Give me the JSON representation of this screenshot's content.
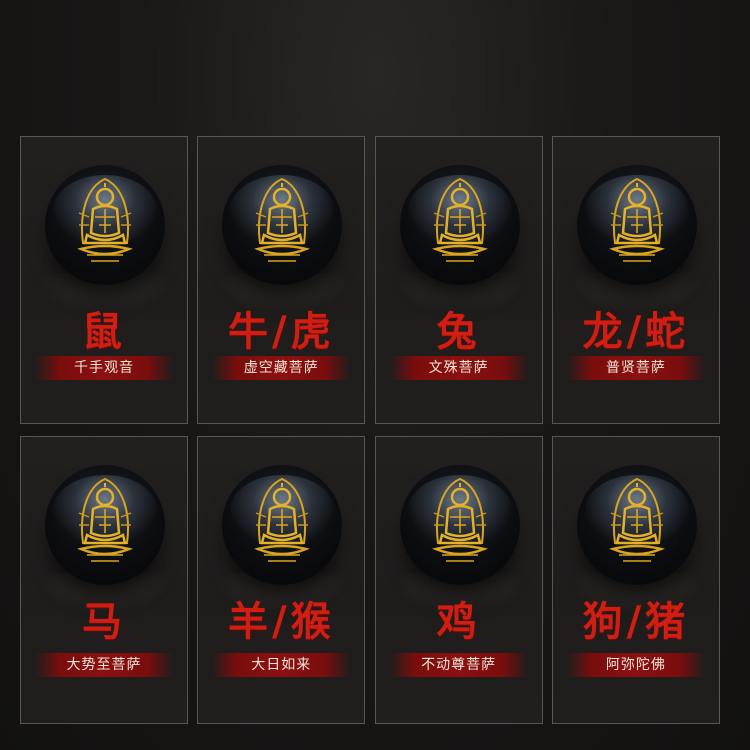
{
  "cards": [
    {
      "zodiac": "鼠",
      "deity": "千手观音"
    },
    {
      "zodiac": "牛/虎",
      "deity": "虚空藏菩萨"
    },
    {
      "zodiac": "兔",
      "deity": "文殊菩萨"
    },
    {
      "zodiac": "龙/蛇",
      "deity": "普贤菩萨"
    },
    {
      "zodiac": "马",
      "deity": "大势至菩萨"
    },
    {
      "zodiac": "羊/猴",
      "deity": "大日如来"
    },
    {
      "zodiac": "鸡",
      "deity": "不动尊菩萨"
    },
    {
      "zodiac": "狗/猪",
      "deity": "阿弥陀佛"
    }
  ],
  "colors": {
    "zodiac_text": "#d21e12",
    "band": "#8c1010",
    "gold": "#d9a520"
  },
  "icons": {
    "figure": "buddha-figure-icon",
    "orb": "obsidian-bead"
  }
}
